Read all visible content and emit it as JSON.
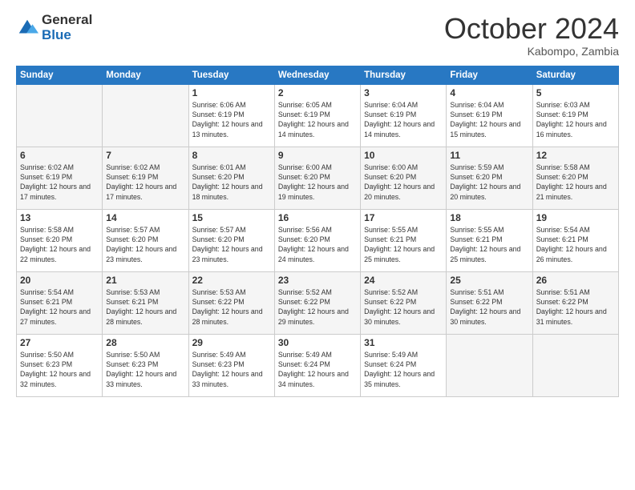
{
  "header": {
    "logo_general": "General",
    "logo_blue": "Blue",
    "month_title": "October 2024",
    "subtitle": "Kabompo, Zambia"
  },
  "days_of_week": [
    "Sunday",
    "Monday",
    "Tuesday",
    "Wednesday",
    "Thursday",
    "Friday",
    "Saturday"
  ],
  "weeks": [
    [
      {
        "day": "",
        "info": ""
      },
      {
        "day": "",
        "info": ""
      },
      {
        "day": "1",
        "info": "Sunrise: 6:06 AM\nSunset: 6:19 PM\nDaylight: 12 hours and 13 minutes."
      },
      {
        "day": "2",
        "info": "Sunrise: 6:05 AM\nSunset: 6:19 PM\nDaylight: 12 hours and 14 minutes."
      },
      {
        "day": "3",
        "info": "Sunrise: 6:04 AM\nSunset: 6:19 PM\nDaylight: 12 hours and 14 minutes."
      },
      {
        "day": "4",
        "info": "Sunrise: 6:04 AM\nSunset: 6:19 PM\nDaylight: 12 hours and 15 minutes."
      },
      {
        "day": "5",
        "info": "Sunrise: 6:03 AM\nSunset: 6:19 PM\nDaylight: 12 hours and 16 minutes."
      }
    ],
    [
      {
        "day": "6",
        "info": "Sunrise: 6:02 AM\nSunset: 6:19 PM\nDaylight: 12 hours and 17 minutes."
      },
      {
        "day": "7",
        "info": "Sunrise: 6:02 AM\nSunset: 6:19 PM\nDaylight: 12 hours and 17 minutes."
      },
      {
        "day": "8",
        "info": "Sunrise: 6:01 AM\nSunset: 6:20 PM\nDaylight: 12 hours and 18 minutes."
      },
      {
        "day": "9",
        "info": "Sunrise: 6:00 AM\nSunset: 6:20 PM\nDaylight: 12 hours and 19 minutes."
      },
      {
        "day": "10",
        "info": "Sunrise: 6:00 AM\nSunset: 6:20 PM\nDaylight: 12 hours and 20 minutes."
      },
      {
        "day": "11",
        "info": "Sunrise: 5:59 AM\nSunset: 6:20 PM\nDaylight: 12 hours and 20 minutes."
      },
      {
        "day": "12",
        "info": "Sunrise: 5:58 AM\nSunset: 6:20 PM\nDaylight: 12 hours and 21 minutes."
      }
    ],
    [
      {
        "day": "13",
        "info": "Sunrise: 5:58 AM\nSunset: 6:20 PM\nDaylight: 12 hours and 22 minutes."
      },
      {
        "day": "14",
        "info": "Sunrise: 5:57 AM\nSunset: 6:20 PM\nDaylight: 12 hours and 23 minutes."
      },
      {
        "day": "15",
        "info": "Sunrise: 5:57 AM\nSunset: 6:20 PM\nDaylight: 12 hours and 23 minutes."
      },
      {
        "day": "16",
        "info": "Sunrise: 5:56 AM\nSunset: 6:20 PM\nDaylight: 12 hours and 24 minutes."
      },
      {
        "day": "17",
        "info": "Sunrise: 5:55 AM\nSunset: 6:21 PM\nDaylight: 12 hours and 25 minutes."
      },
      {
        "day": "18",
        "info": "Sunrise: 5:55 AM\nSunset: 6:21 PM\nDaylight: 12 hours and 25 minutes."
      },
      {
        "day": "19",
        "info": "Sunrise: 5:54 AM\nSunset: 6:21 PM\nDaylight: 12 hours and 26 minutes."
      }
    ],
    [
      {
        "day": "20",
        "info": "Sunrise: 5:54 AM\nSunset: 6:21 PM\nDaylight: 12 hours and 27 minutes."
      },
      {
        "day": "21",
        "info": "Sunrise: 5:53 AM\nSunset: 6:21 PM\nDaylight: 12 hours and 28 minutes."
      },
      {
        "day": "22",
        "info": "Sunrise: 5:53 AM\nSunset: 6:22 PM\nDaylight: 12 hours and 28 minutes."
      },
      {
        "day": "23",
        "info": "Sunrise: 5:52 AM\nSunset: 6:22 PM\nDaylight: 12 hours and 29 minutes."
      },
      {
        "day": "24",
        "info": "Sunrise: 5:52 AM\nSunset: 6:22 PM\nDaylight: 12 hours and 30 minutes."
      },
      {
        "day": "25",
        "info": "Sunrise: 5:51 AM\nSunset: 6:22 PM\nDaylight: 12 hours and 30 minutes."
      },
      {
        "day": "26",
        "info": "Sunrise: 5:51 AM\nSunset: 6:22 PM\nDaylight: 12 hours and 31 minutes."
      }
    ],
    [
      {
        "day": "27",
        "info": "Sunrise: 5:50 AM\nSunset: 6:23 PM\nDaylight: 12 hours and 32 minutes."
      },
      {
        "day": "28",
        "info": "Sunrise: 5:50 AM\nSunset: 6:23 PM\nDaylight: 12 hours and 33 minutes."
      },
      {
        "day": "29",
        "info": "Sunrise: 5:49 AM\nSunset: 6:23 PM\nDaylight: 12 hours and 33 minutes."
      },
      {
        "day": "30",
        "info": "Sunrise: 5:49 AM\nSunset: 6:24 PM\nDaylight: 12 hours and 34 minutes."
      },
      {
        "day": "31",
        "info": "Sunrise: 5:49 AM\nSunset: 6:24 PM\nDaylight: 12 hours and 35 minutes."
      },
      {
        "day": "",
        "info": ""
      },
      {
        "day": "",
        "info": ""
      }
    ]
  ]
}
